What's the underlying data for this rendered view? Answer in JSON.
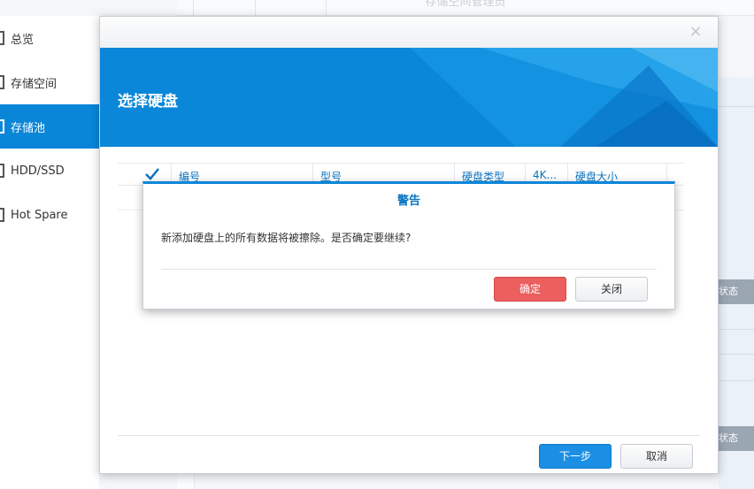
{
  "background": {
    "title": "存储空间管理员",
    "sidebar": [
      {
        "label": "总览",
        "active": false
      },
      {
        "label": "存储空间",
        "active": false
      },
      {
        "label": "存储池",
        "active": true
      },
      {
        "label": "HDD/SSD",
        "active": false
      },
      {
        "label": "Hot Spare",
        "active": false
      }
    ],
    "status_label_1": "状态",
    "status_label_2": "状态"
  },
  "wizard": {
    "title": "选择硬盘",
    "close_icon": "×",
    "table": {
      "columns": [
        "编号",
        "型号",
        "硬盘类型",
        "4K...",
        "硬盘大小"
      ]
    },
    "next_button": "下一步",
    "cancel_button": "取消"
  },
  "alert": {
    "title": "警告",
    "message": "新添加硬盘上的所有数据将被擦除。是否确定要继续?",
    "confirm_button": "确定",
    "close_button": "关闭"
  },
  "colors": {
    "accent": "#0a86d8",
    "danger": "#ec5f5f"
  }
}
